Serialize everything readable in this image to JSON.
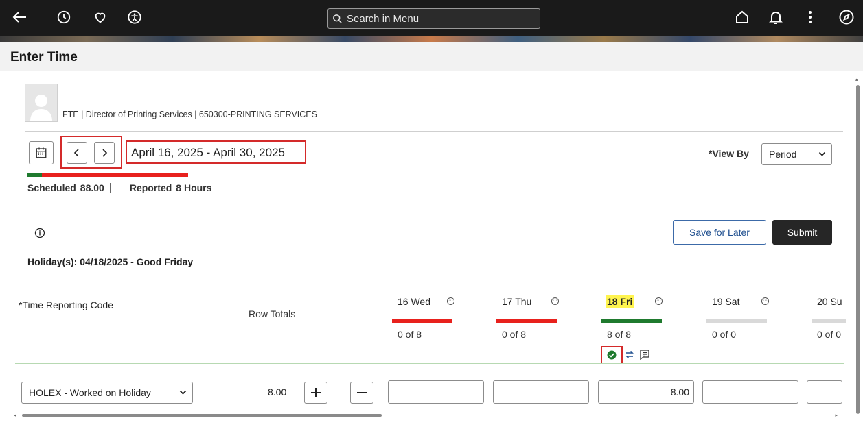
{
  "topbar": {
    "search_placeholder": "Search in Menu"
  },
  "page": {
    "title": "Enter Time"
  },
  "employee": {
    "info": "FTE | Director of Printing Services | 650300-PRINTING SERVICES"
  },
  "period": {
    "range": "April 16, 2025 - April 30, 2025",
    "scheduled_label": "Scheduled",
    "scheduled_value": "88.00",
    "reported_label": "Reported",
    "reported_value": "8 Hours",
    "reported_fraction": 0.09
  },
  "view_by": {
    "label": "*View By",
    "selected": "Period"
  },
  "actions": {
    "save_label": "Save for Later",
    "submit_label": "Submit"
  },
  "holiday": {
    "text": "Holiday(s): 04/18/2025 - Good Friday"
  },
  "grid": {
    "trc_header": "*Time Reporting Code",
    "row_totals_header": "Row Totals",
    "days": [
      {
        "label": "16 Wed",
        "count": "0 of 8",
        "status": "red",
        "highlight": false
      },
      {
        "label": "17 Thu",
        "count": "0 of 8",
        "status": "red",
        "highlight": false
      },
      {
        "label": "18 Fri",
        "count": "8 of 8",
        "status": "green",
        "highlight": true
      },
      {
        "label": "19 Sat",
        "count": "0 of 0",
        "status": "gray",
        "highlight": false
      },
      {
        "label": "20 Su",
        "count": "0 of 0",
        "status": "gray",
        "highlight": false
      }
    ],
    "row": {
      "trc_selected": "HOLEX - Worked on Holiday",
      "total": "8.00",
      "values": [
        "",
        "",
        "8.00",
        "",
        ""
      ]
    }
  },
  "colors": {
    "status_red": "#e8211d",
    "status_green": "#1f7a2e",
    "status_gray": "#d9d9d9",
    "highlight_box": "#d42a2a"
  }
}
